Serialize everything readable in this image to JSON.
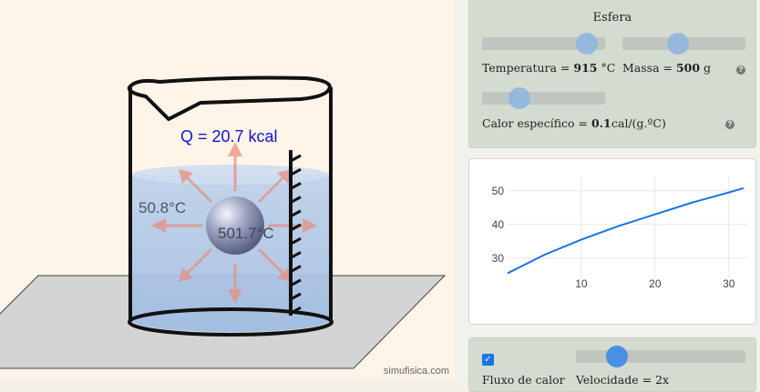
{
  "simulation": {
    "heat_label": "Q = 20.7 kcal",
    "water_temp": "50.8°C",
    "sphere_temp": "501.7°C",
    "credit": "simufisica.com"
  },
  "sphere_panel": {
    "title": "Esfera",
    "temperature": {
      "prefix": "Temperatura = ",
      "value": "915",
      "unit": " °C",
      "level": 0.85
    },
    "mass": {
      "prefix": "Massa = ",
      "value": "500",
      "unit": " g",
      "level": 0.45
    },
    "specific_heat": {
      "prefix": "Calor específico = ",
      "value": "0.1",
      "unit": "cal/(g.ºC)",
      "level": 0.3
    }
  },
  "chart_data": {
    "type": "line",
    "x": [
      0,
      5,
      10,
      15,
      20,
      25,
      30,
      32
    ],
    "y": [
      25.5,
      31,
      35.5,
      39.5,
      43,
      46.5,
      49.5,
      50.8
    ],
    "xticks": [
      "10",
      "20",
      "30"
    ],
    "yticks": [
      "30",
      "40",
      "50"
    ],
    "xlim": [
      0,
      32.5
    ],
    "ylim": [
      24,
      54
    ],
    "grid": true,
    "line_color": "#1a73e8"
  },
  "bottom_panel": {
    "checkbox_checked": true,
    "checkbox_mark": "✓",
    "slider_level": 0.24,
    "label1": "Fluxo de calor",
    "label2": "Velocidade = 2x"
  }
}
